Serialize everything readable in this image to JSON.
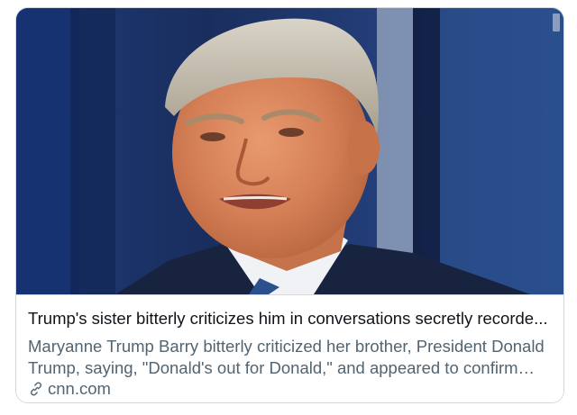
{
  "card": {
    "image_alt": "Donald Trump speaking against a dark blue background",
    "headline": "Trump's sister bitterly criticizes him in conversations secretly recorde...",
    "description": "Maryanne Trump Barry bitterly criticized her brother, President Donald Trump, saying, \"Donald's out for Donald,\" and appeared to confirm he...",
    "source_icon": "link-icon",
    "source": "cnn.com"
  },
  "colors": {
    "border": "#cfd9de",
    "headline": "#0f1419",
    "secondary": "#536471"
  }
}
